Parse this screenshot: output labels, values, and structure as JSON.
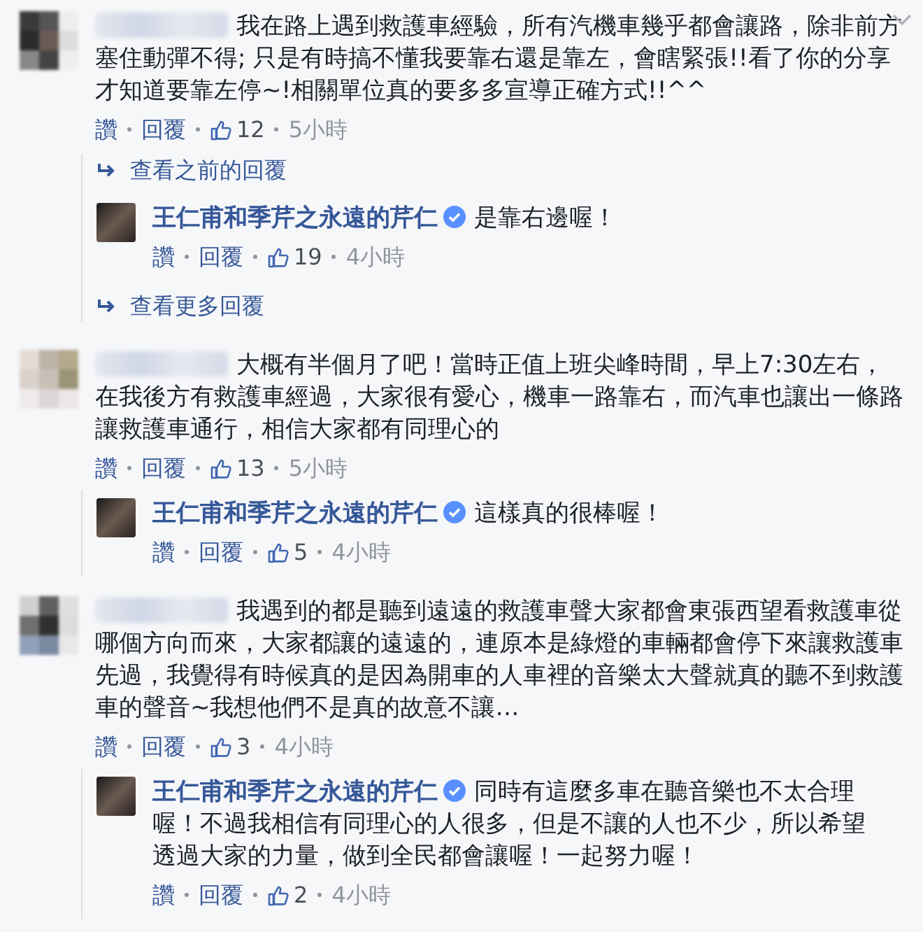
{
  "comments": [
    {
      "text": "我在路上遇到救護車經驗，所有汽機車幾乎都會讓路，除非前方塞住動彈不得; 只是有時搞不懂我要靠右還是靠左，會瞎緊張!!看了你的分享才知道要靠左停~!相關單位真的要多多宣導正確方式!!^^",
      "menu": true,
      "actions": {
        "like": "讚",
        "reply": "回覆",
        "likes": "12",
        "time": "5小時"
      },
      "previous_link": "查看之前的回覆",
      "replies": [
        {
          "author": "王仁甫和季芹之永遠的芹仁",
          "verified": true,
          "text": "是靠右邊喔！",
          "actions": {
            "like": "讚",
            "reply": "回覆",
            "likes": "19",
            "time": "4小時"
          }
        }
      ],
      "more_link": "查看更多回覆"
    },
    {
      "text": "大概有半個月了吧！當時正值上班尖峰時間，早上7:30左右，在我後方有救護車經過，大家很有愛心，機車一路靠右，而汽車也讓出一條路讓救護車通行，相信大家都有同理心的",
      "menu": false,
      "actions": {
        "like": "讚",
        "reply": "回覆",
        "likes": "13",
        "time": "5小時"
      },
      "replies": [
        {
          "author": "王仁甫和季芹之永遠的芹仁",
          "verified": true,
          "text": "這樣真的很棒喔！",
          "actions": {
            "like": "讚",
            "reply": "回覆",
            "likes": "5",
            "time": "4小時"
          }
        }
      ]
    },
    {
      "text": "我遇到的都是聽到遠遠的救護車聲大家都會東張西望看救護車從哪個方向而來，大家都讓的遠遠的，連原本是綠燈的車輛都會停下來讓救護車先過，我覺得有時候真的是因為開車的人車裡的音樂太大聲就真的聽不到救護車的聲音~我想他們不是真的故意不讓…",
      "menu": false,
      "actions": {
        "like": "讚",
        "reply": "回覆",
        "likes": "3",
        "time": "4小時"
      },
      "replies": [
        {
          "author": "王仁甫和季芹之永遠的芹仁",
          "verified": true,
          "text": "同時有這麼多車在聽音樂也不太合理喔！不過我相信有同理心的人很多，但是不讓的人也不少，所以希望透過大家的力量，做到全民都會讓喔！一起努力喔！",
          "actions": {
            "like": "讚",
            "reply": "回覆",
            "likes": "2",
            "time": "4小時"
          }
        }
      ]
    }
  ]
}
